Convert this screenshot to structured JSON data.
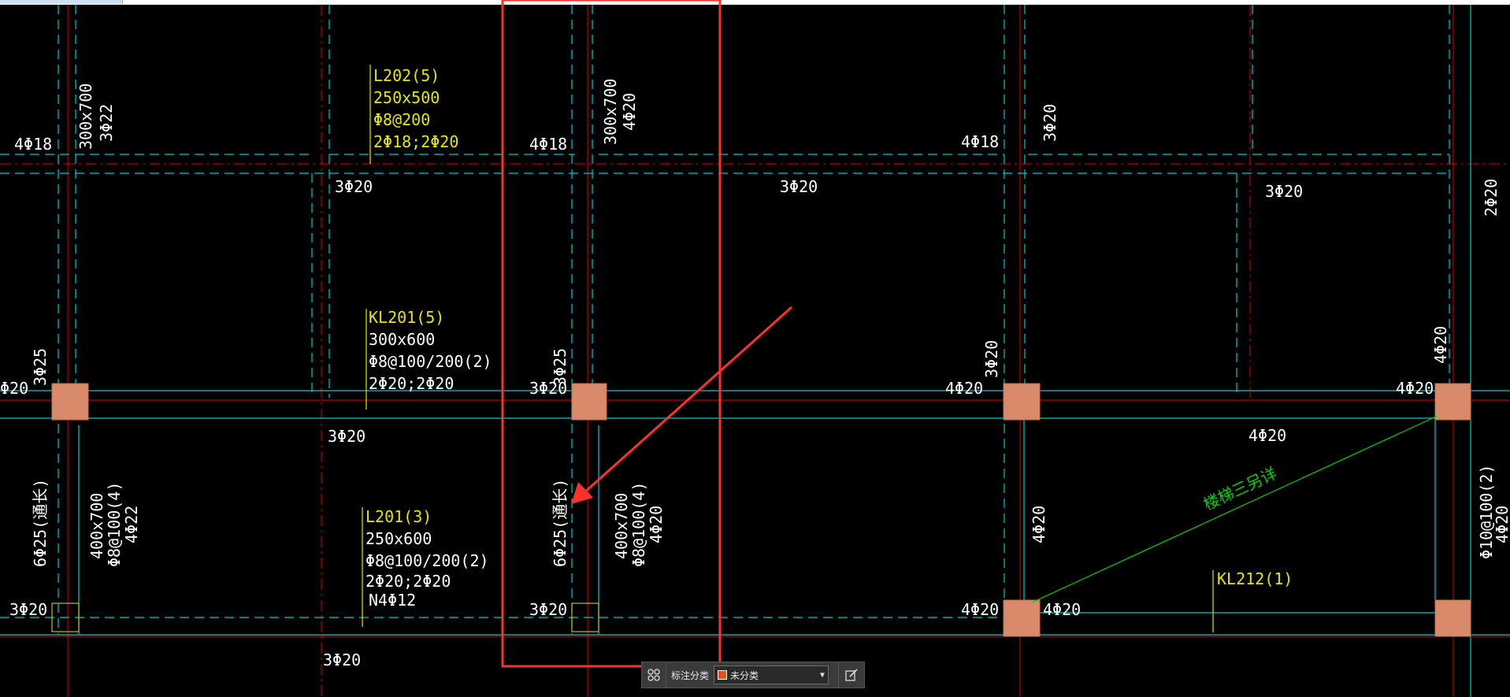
{
  "colors": {
    "background": "#000000",
    "axis_red": "#e00000",
    "beam_cyan": "#00c8d2",
    "label_yellow": "#e6e600",
    "label_white": "#ffffff",
    "stair_green": "#00d000",
    "column_fill": "#d98a6a",
    "highlight_red": "#ff3030"
  },
  "drawing": {
    "beam_labels": [
      {
        "name": "L202(5)",
        "size": "250x500",
        "stirrup": "Φ8@200",
        "bars": "2Φ18;2Φ20"
      },
      {
        "name": "KL201(5)",
        "size": "300x600",
        "stirrup": "Φ8@100/200(2)",
        "bars": "2Φ20;2Φ20"
      },
      {
        "name": "L201(3)",
        "size": "250x600",
        "stirrup": "Φ8@100/200(2)",
        "bars": "2Φ20;2Φ20",
        "extra": "N4Φ12"
      },
      {
        "name": "KL212(1)"
      }
    ],
    "rebar": {
      "b4_18": "4Φ18",
      "b3_20": "3Φ20",
      "b4_20": "4Φ20",
      "b2_20": "2Φ20",
      "b3_22": "3Φ22",
      "b3_25": "3Φ25",
      "b4_22": "4Φ22",
      "b6_25": "6Φ25(通长)",
      "phi20": "Φ20",
      "sec300": "300x700",
      "sec400": "400x700",
      "stir4": "Φ8@100(4)",
      "stir_c": "Φ10@100(2)"
    },
    "stair_note": "楼梯三另详"
  },
  "toolbar": {
    "grip_icon": "grid-dots-icon",
    "label": "标注分类",
    "select_value": "未分类",
    "swatch_color": "#d9541e",
    "edit_icon": "edit-icon"
  }
}
